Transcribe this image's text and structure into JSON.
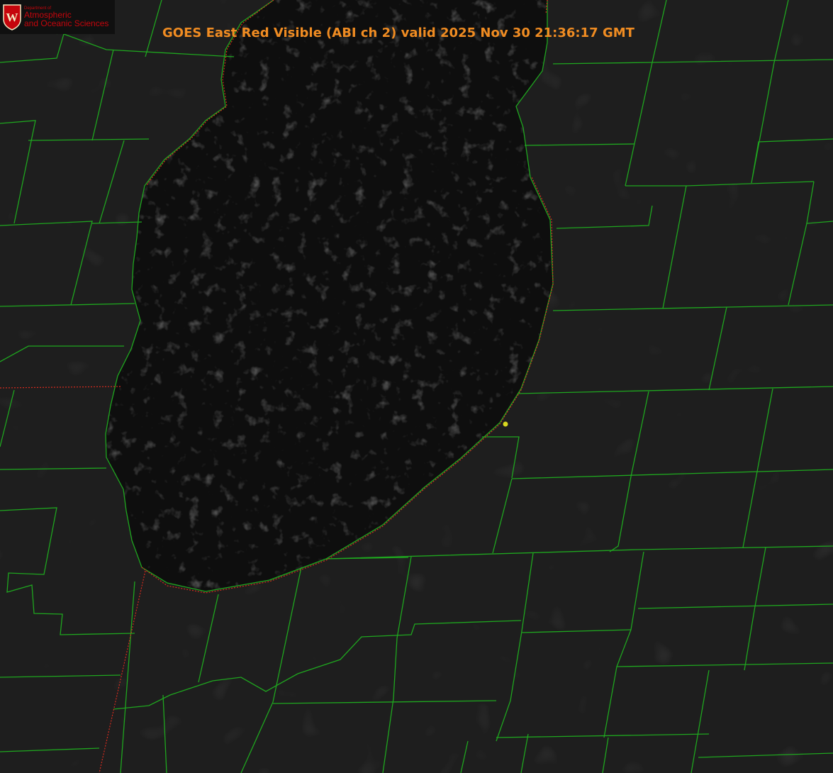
{
  "title": "GOES East Red Visible (ABI ch 2) valid 2025 Nov 30 21:36:17 GMT",
  "logo": {
    "department": "Department of",
    "name_line1": "Atmospheric",
    "name_line2": "and Oceanic Sciences",
    "seal_letter": "W"
  },
  "map": {
    "channel": "ABI ch 2 (0.64 µm red visible)",
    "colors": {
      "land": "#1e1e1e",
      "lake": "#0e0e0e",
      "county_lines": "#1fa61f",
      "shoreline": "#1fa61f",
      "state_lines": "#d62b1e",
      "marker": "#d8d820",
      "title": "#f08c22",
      "logo_red": "#c5050c"
    },
    "icons": [
      "station-marker-icon",
      "uw-seal-icon"
    ]
  }
}
